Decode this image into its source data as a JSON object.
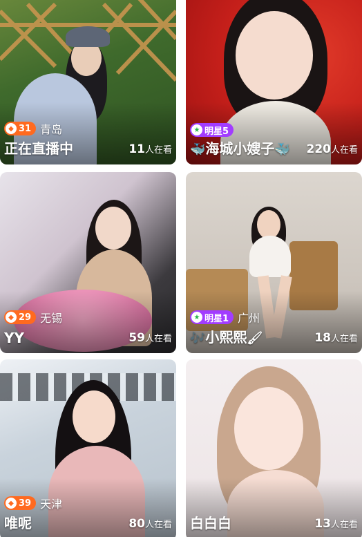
{
  "cards": [
    {
      "city": "青岛",
      "title": "正在直播中",
      "viewers": "11",
      "viewers_label": "人在看",
      "badge": {
        "kind": "level",
        "value": "31",
        "color": "#ff6a1f"
      }
    },
    {
      "city": "",
      "title": "海城小嫂子",
      "viewers": "220",
      "viewers_label": "人在看",
      "badge": {
        "kind": "star",
        "value": "明星5",
        "color": "#a23cff"
      },
      "title_deco": "whale-icon"
    },
    {
      "city": "无锡",
      "title": "YY",
      "viewers": "59",
      "viewers_label": "人在看",
      "badge": {
        "kind": "level",
        "value": "29",
        "color": "#ff6a1f"
      }
    },
    {
      "city": "广州",
      "title": "小熙熙",
      "viewers": "18",
      "viewers_label": "人在看",
      "badge": {
        "kind": "star",
        "value": "明星1",
        "color": "#a23cff"
      },
      "title_deco": "music-note-icon"
    },
    {
      "city": "天津",
      "title": "唯呢",
      "viewers": "80",
      "viewers_label": "人在看",
      "badge": {
        "kind": "level",
        "value": "39",
        "color": "#ff6a1f"
      }
    },
    {
      "city": "",
      "title": "白白白",
      "viewers": "13",
      "viewers_label": "人在看",
      "badge": null
    }
  ]
}
